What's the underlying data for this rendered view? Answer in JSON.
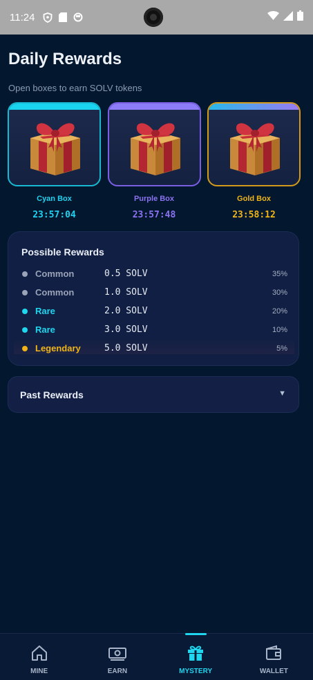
{
  "status_bar": {
    "time": "11:24"
  },
  "header": {
    "title": "Daily Rewards",
    "subtitle": "Open boxes to earn SOLV tokens"
  },
  "boxes": [
    {
      "name": "Cyan Box",
      "timer": "23:57:04",
      "color": "#20d2ef"
    },
    {
      "name": "Purple Box",
      "timer": "23:57:48",
      "color": "#8c72f0"
    },
    {
      "name": "Gold Box",
      "timer": "23:58:12",
      "color": "#f0b419"
    }
  ],
  "possible_rewards": {
    "title": "Possible Rewards",
    "rows": [
      {
        "tier": "Common",
        "amount": "0.5 SOLV",
        "chance": "35%",
        "color": "#9aa3b8"
      },
      {
        "tier": "Common",
        "amount": "1.0 SOLV",
        "chance": "30%",
        "color": "#9aa3b8"
      },
      {
        "tier": "Rare",
        "amount": "2.0 SOLV",
        "chance": "20%",
        "color": "#1fd6ee"
      },
      {
        "tier": "Rare",
        "amount": "3.0 SOLV",
        "chance": "10%",
        "color": "#1fd6ee"
      },
      {
        "tier": "Legendary",
        "amount": "5.0 SOLV",
        "chance": "5%",
        "color": "#f0b419"
      }
    ]
  },
  "past_rewards": {
    "label": "Past Rewards",
    "arrow": "▼"
  },
  "nav": {
    "items": [
      {
        "label": "MINE",
        "icon": "home-icon"
      },
      {
        "label": "EARN",
        "icon": "cash-icon"
      },
      {
        "label": "MYSTERY",
        "icon": "gift-icon",
        "active": true
      },
      {
        "label": "WALLET",
        "icon": "wallet-icon"
      }
    ]
  },
  "colors": {
    "background": "#03182f",
    "accent": "#1fd6ee"
  }
}
